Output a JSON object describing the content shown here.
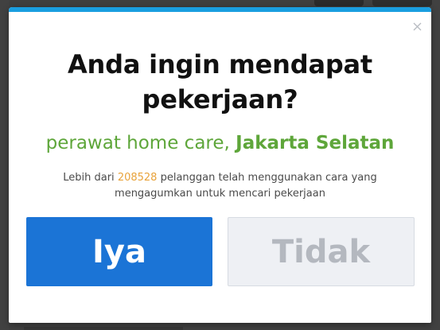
{
  "modal": {
    "title_line1": "Anda ingin mendapat",
    "title_line2": "pekerjaan?",
    "job_title": "perawat home care,",
    "location": "Jakarta Selatan",
    "desc_prefix": "Lebih dari",
    "user_count": "208528",
    "desc_suffix": "pelanggan telah menggunakan cara yang",
    "desc_line2": "mengagumkan untuk mencari pekerjaan",
    "yes_label": "Iya",
    "no_label": "Tidak"
  },
  "colors": {
    "accent_bar": "#1a9ee0",
    "primary_button": "#1b74d6",
    "job_text": "#5ea63a",
    "count_text": "#e8a23a"
  },
  "icons": {
    "close": "close-icon"
  }
}
